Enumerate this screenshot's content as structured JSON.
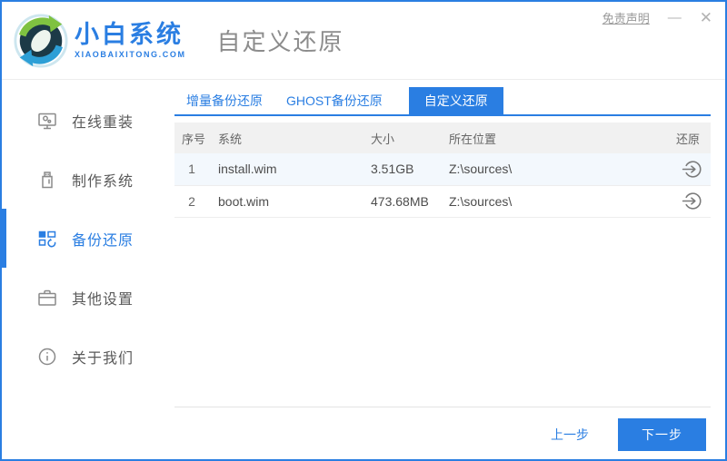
{
  "window": {
    "disclaimer": "免责声明",
    "minimize": "—",
    "close": "✕"
  },
  "brand": {
    "name": "小白系统",
    "domain": "XIAOBAIXITONG.COM",
    "logo_icon": "sync-arrows-logo-icon"
  },
  "header": {
    "title": "自定义还原"
  },
  "sidebar": {
    "items": [
      {
        "label": "在线重装",
        "icon": "monitor-reinstall-icon",
        "active": false
      },
      {
        "label": "制作系统",
        "icon": "usb-drive-icon",
        "active": false
      },
      {
        "label": "备份还原",
        "icon": "backup-grid-icon",
        "active": true
      },
      {
        "label": "其他设置",
        "icon": "settings-case-icon",
        "active": false
      },
      {
        "label": "关于我们",
        "icon": "info-circle-icon",
        "active": false
      }
    ]
  },
  "tabs": [
    {
      "label": "增量备份还原",
      "active": false
    },
    {
      "label": "GHOST备份还原",
      "active": false
    },
    {
      "label": "自定义还原",
      "active": true
    }
  ],
  "table": {
    "columns": [
      "序号",
      "系统",
      "大小",
      "所在位置",
      "还原"
    ],
    "rows": [
      {
        "index": "1",
        "system": "install.wim",
        "size": "3.51GB",
        "location": "Z:\\sources\\",
        "action_icon": "restore-icon"
      },
      {
        "index": "2",
        "system": "boot.wim",
        "size": "473.68MB",
        "location": "Z:\\sources\\",
        "action_icon": "restore-icon"
      }
    ]
  },
  "footer": {
    "prev_label": "上一步",
    "next_label": "下一步"
  },
  "colors": {
    "accent_blue": "#2a7ee2",
    "title_gray": "#8c8c8c",
    "table_header_bg": "#f1f1f1",
    "row_alt_bg": "#f3f8fd",
    "logo_green": "#7fc241",
    "logo_light_blue": "#2d9fd6"
  }
}
